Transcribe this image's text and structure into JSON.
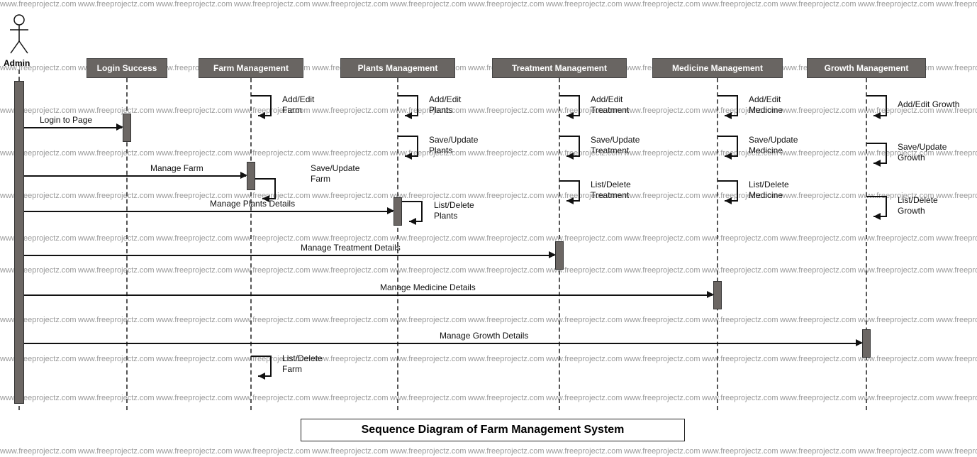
{
  "actor": {
    "label": "Admin"
  },
  "participants": {
    "login": "Login Success",
    "farm": "Farm Management",
    "plants": "Plants Management",
    "treatment": "Treatment Management",
    "medicine": "Medicine Management",
    "growth": "Growth Management"
  },
  "messages": {
    "login_to_page": "Login to Page",
    "manage_farm": "Manage Farm",
    "manage_plants": "Manage Plants Details",
    "manage_treatment": "Manage Treatment Details",
    "manage_medicine": "Manage Medicine Details",
    "manage_growth": "Manage Growth Details"
  },
  "self": {
    "farm": {
      "addedit": "Add/Edit Farm",
      "saveupdate": "Save/Update Farm",
      "listdelete": "List/Delete Farm"
    },
    "plants": {
      "addedit": "Add/Edit Plants",
      "saveupdate": "Save/Update Plants",
      "listdelete": "List/Delete Plants"
    },
    "treatment": {
      "addedit": "Add/Edit Treatment",
      "saveupdate": "Save/Update Treatment",
      "listdelete": "List/Delete Treatment"
    },
    "medicine": {
      "addedit": "Add/Edit Medicine",
      "saveupdate": "Save/Update Medicine",
      "listdelete": "List/Delete Medicine"
    },
    "growth": {
      "addedit": "Add/Edit Growth",
      "saveupdate": "Save/Update Growth",
      "listdelete": "List/Delete Growth"
    }
  },
  "title": "Sequence Diagram of Farm Management System",
  "watermark": "www.freeprojectz.com"
}
